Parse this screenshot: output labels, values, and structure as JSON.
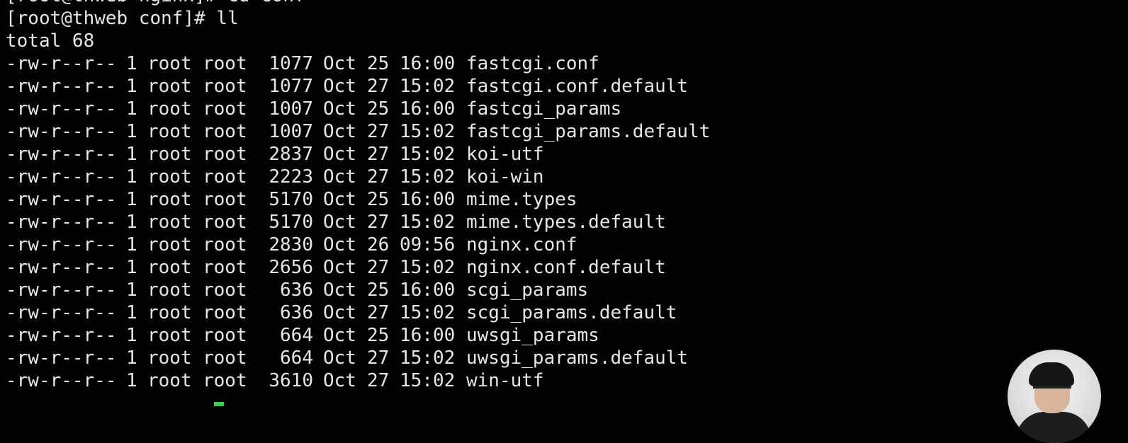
{
  "terminal": {
    "prompt_lines": [
      "[root@thweb nginx]# cd conf",
      "[root@thweb conf]# ll"
    ],
    "total_line": "total 68",
    "files": [
      {
        "perm": "-rw-r--r--",
        "links": "1",
        "owner": "root",
        "group": "root",
        "size": "1077",
        "month": "Oct",
        "day": "25",
        "time": "16:00",
        "name": "fastcgi.conf"
      },
      {
        "perm": "-rw-r--r--",
        "links": "1",
        "owner": "root",
        "group": "root",
        "size": "1077",
        "month": "Oct",
        "day": "27",
        "time": "15:02",
        "name": "fastcgi.conf.default"
      },
      {
        "perm": "-rw-r--r--",
        "links": "1",
        "owner": "root",
        "group": "root",
        "size": "1007",
        "month": "Oct",
        "day": "25",
        "time": "16:00",
        "name": "fastcgi_params"
      },
      {
        "perm": "-rw-r--r--",
        "links": "1",
        "owner": "root",
        "group": "root",
        "size": "1007",
        "month": "Oct",
        "day": "27",
        "time": "15:02",
        "name": "fastcgi_params.default"
      },
      {
        "perm": "-rw-r--r--",
        "links": "1",
        "owner": "root",
        "group": "root",
        "size": "2837",
        "month": "Oct",
        "day": "27",
        "time": "15:02",
        "name": "koi-utf"
      },
      {
        "perm": "-rw-r--r--",
        "links": "1",
        "owner": "root",
        "group": "root",
        "size": "2223",
        "month": "Oct",
        "day": "27",
        "time": "15:02",
        "name": "koi-win"
      },
      {
        "perm": "-rw-r--r--",
        "links": "1",
        "owner": "root",
        "group": "root",
        "size": "5170",
        "month": "Oct",
        "day": "25",
        "time": "16:00",
        "name": "mime.types"
      },
      {
        "perm": "-rw-r--r--",
        "links": "1",
        "owner": "root",
        "group": "root",
        "size": "5170",
        "month": "Oct",
        "day": "27",
        "time": "15:02",
        "name": "mime.types.default"
      },
      {
        "perm": "-rw-r--r--",
        "links": "1",
        "owner": "root",
        "group": "root",
        "size": "2830",
        "month": "Oct",
        "day": "26",
        "time": "09:56",
        "name": "nginx.conf"
      },
      {
        "perm": "-rw-r--r--",
        "links": "1",
        "owner": "root",
        "group": "root",
        "size": "2656",
        "month": "Oct",
        "day": "27",
        "time": "15:02",
        "name": "nginx.conf.default"
      },
      {
        "perm": "-rw-r--r--",
        "links": "1",
        "owner": "root",
        "group": "root",
        "size": "636",
        "month": "Oct",
        "day": "25",
        "time": "16:00",
        "name": "scgi_params"
      },
      {
        "perm": "-rw-r--r--",
        "links": "1",
        "owner": "root",
        "group": "root",
        "size": "636",
        "month": "Oct",
        "day": "27",
        "time": "15:02",
        "name": "scgi_params.default"
      },
      {
        "perm": "-rw-r--r--",
        "links": "1",
        "owner": "root",
        "group": "root",
        "size": "664",
        "month": "Oct",
        "day": "25",
        "time": "16:00",
        "name": "uwsgi_params"
      },
      {
        "perm": "-rw-r--r--",
        "links": "1",
        "owner": "root",
        "group": "root",
        "size": "664",
        "month": "Oct",
        "day": "27",
        "time": "15:02",
        "name": "uwsgi_params.default"
      },
      {
        "perm": "-rw-r--r--",
        "links": "1",
        "owner": "root",
        "group": "root",
        "size": "3610",
        "month": "Oct",
        "day": "27",
        "time": "15:02",
        "name": "win-utf"
      }
    ]
  },
  "colors": {
    "background": "#000000",
    "text": "#e6e6e6",
    "cursor": "#3ccf4e"
  },
  "overlay": {
    "webcam_icon": "person-webcam-icon"
  }
}
